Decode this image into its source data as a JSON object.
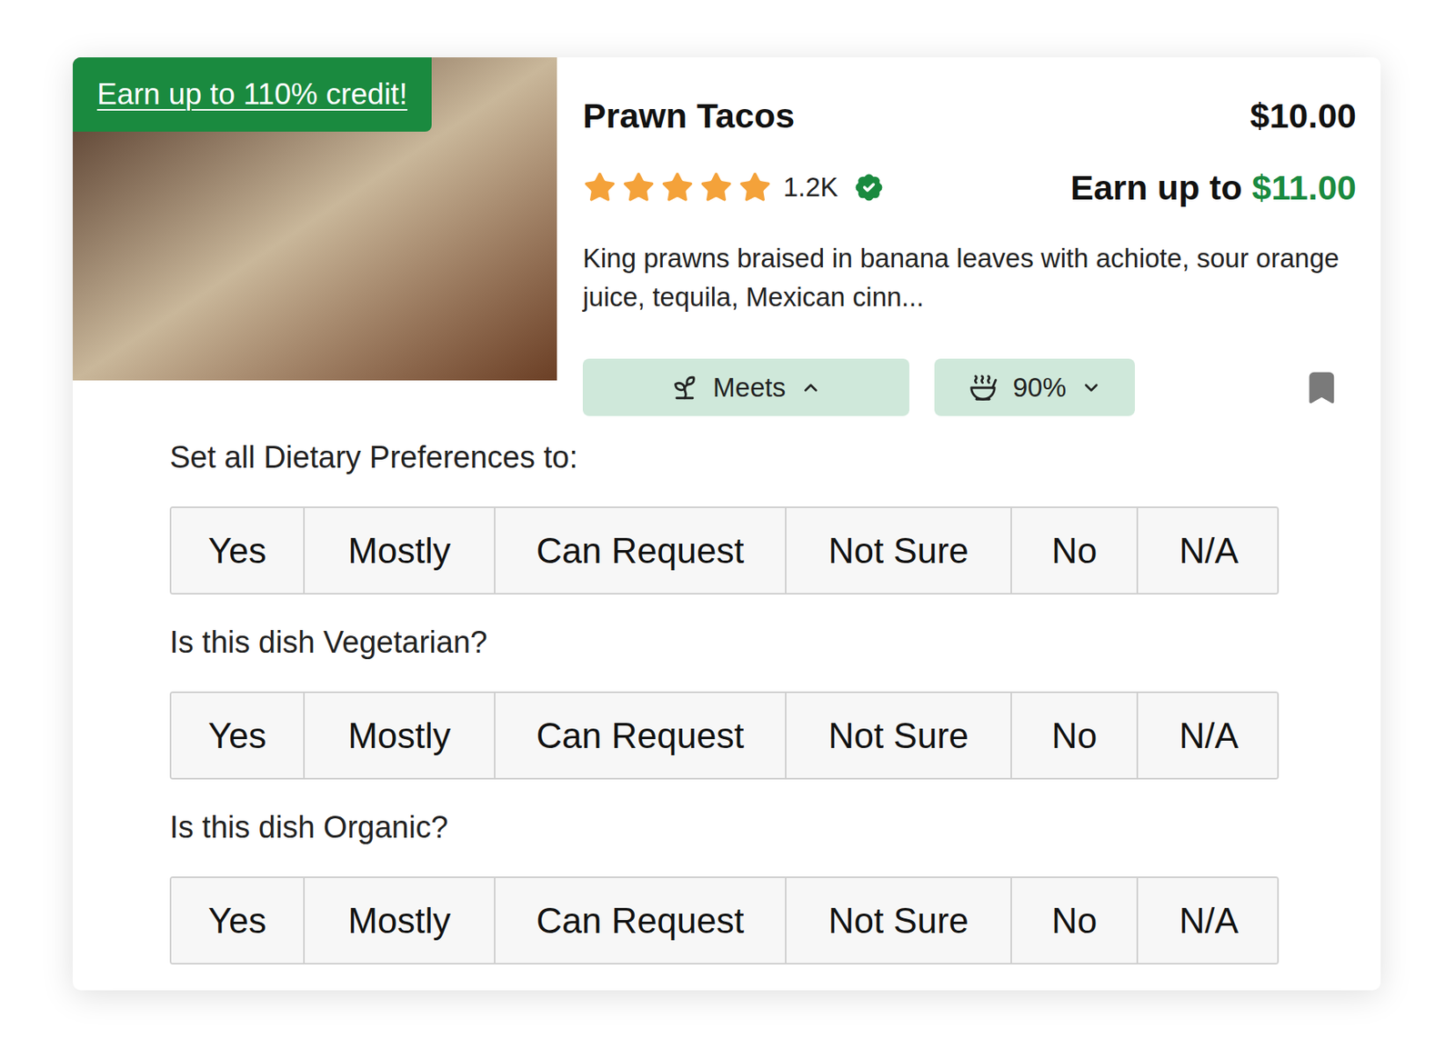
{
  "card": {
    "badge": "Earn up to 110% credit!",
    "title": "Prawn Tacos",
    "price": "$10.00",
    "earn": {
      "label": "Earn up to",
      "amount": "$11.00"
    },
    "rating": {
      "stars": 5,
      "count": "1.2K",
      "verified": true
    },
    "description": "King prawns braised in banana leaves with achiote, sour orange juice, tequila, Mexican cinn...",
    "pills": [
      {
        "label": "Meets",
        "kind": "diet",
        "expanded": true
      },
      {
        "label": "90%",
        "kind": "match",
        "expanded": false
      }
    ],
    "bookmarked": false
  },
  "preferences": {
    "groups": [
      {
        "question": "Set all Dietary Preferences to:",
        "options": [
          {
            "label": "Yes",
            "selected": false
          },
          {
            "label": "Mostly",
            "selected": false
          },
          {
            "label": "Can Request",
            "selected": false
          },
          {
            "label": "Not Sure",
            "selected": false
          },
          {
            "label": "No",
            "selected": false
          },
          {
            "label": "N/A",
            "selected": false
          }
        ]
      },
      {
        "question": "Is this dish Vegetarian?",
        "options": [
          {
            "label": "Yes",
            "selected": false
          },
          {
            "label": "Mostly",
            "selected": false
          },
          {
            "label": "Can Request",
            "selected": false
          },
          {
            "label": "Not Sure",
            "selected": false
          },
          {
            "label": "No",
            "selected": false
          },
          {
            "label": "N/A",
            "selected": false
          }
        ]
      },
      {
        "question": "Is this dish Organic?",
        "options": [
          {
            "label": "Yes",
            "selected": false
          },
          {
            "label": "Mostly",
            "selected": false
          },
          {
            "label": "Can Request",
            "selected": false
          },
          {
            "label": "Not Sure",
            "selected": false
          },
          {
            "label": "No",
            "selected": false
          },
          {
            "label": "N/A",
            "selected": false
          }
        ]
      }
    ]
  }
}
